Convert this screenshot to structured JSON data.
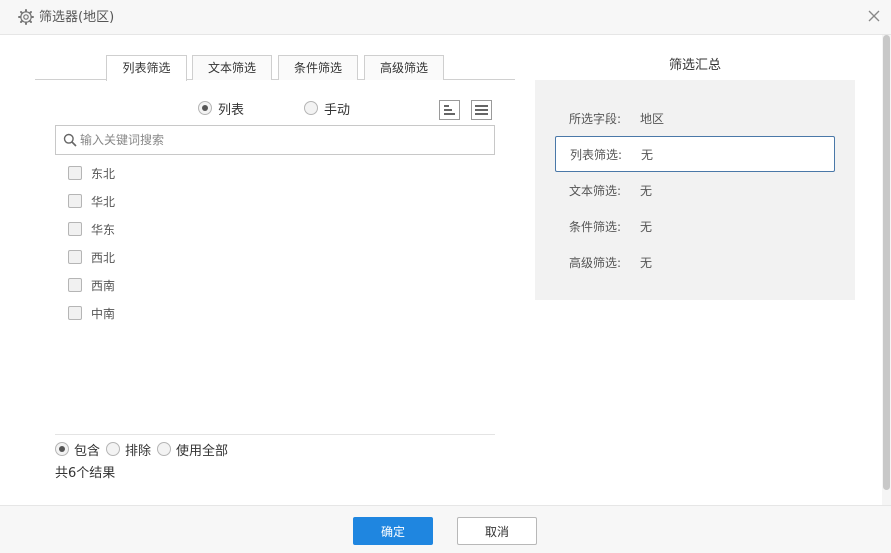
{
  "dialog": {
    "title": "筛选器(地区)"
  },
  "tabs": [
    {
      "label": "列表筛选",
      "active": true
    },
    {
      "label": "文本筛选",
      "active": false
    },
    {
      "label": "条件筛选",
      "active": false
    },
    {
      "label": "高级筛选",
      "active": false
    }
  ],
  "list_mode": {
    "options": [
      {
        "label": "列表",
        "checked": true
      },
      {
        "label": "手动",
        "checked": false
      }
    ]
  },
  "search": {
    "placeholder": "输入关键词搜索",
    "value": ""
  },
  "items": [
    {
      "label": "东北",
      "checked": false
    },
    {
      "label": "华北",
      "checked": false
    },
    {
      "label": "华东",
      "checked": false
    },
    {
      "label": "西北",
      "checked": false
    },
    {
      "label": "西南",
      "checked": false
    },
    {
      "label": "中南",
      "checked": false
    }
  ],
  "match_mode": {
    "options": [
      {
        "label": "包含",
        "checked": true
      },
      {
        "label": "排除",
        "checked": false
      },
      {
        "label": "使用全部",
        "checked": false
      }
    ]
  },
  "result_count": "共6个结果",
  "summary": {
    "title": "筛选汇总",
    "rows": [
      {
        "key": "所选字段:",
        "value": "地区"
      },
      {
        "key": "列表筛选:",
        "value": "无"
      },
      {
        "key": "文本筛选:",
        "value": "无"
      },
      {
        "key": "条件筛选:",
        "value": "无"
      },
      {
        "key": "高级筛选:",
        "value": "无"
      }
    ]
  },
  "footer": {
    "ok_label": "确定",
    "cancel_label": "取消"
  },
  "colors": {
    "primary": "#1f86e0",
    "active_border": "#4a78a8",
    "panel_bg": "#f2f2f2"
  },
  "icons": {
    "title": "gear-icon",
    "close": "close-icon",
    "sort": "sort-icon",
    "menu": "menu-icon",
    "search": "search-icon"
  }
}
